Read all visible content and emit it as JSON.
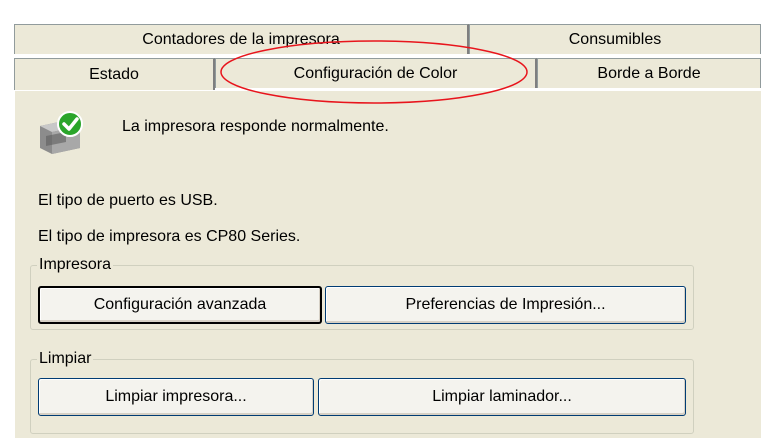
{
  "tabs_back": {
    "printer_counters": "Contadores de la impresora",
    "consumables": "Consumibles"
  },
  "tabs_front": {
    "status": "Estado",
    "color_config": "Configuración de Color",
    "borderless": "Borde a Borde"
  },
  "status_message": "La impresora responde normalmente.",
  "port_info": "El tipo de puerto es USB.",
  "printer_type_info": "El tipo de impresora es CP80 Series.",
  "printer_group": {
    "legend": "Impresora",
    "advanced_button": "Configuración avanzada",
    "preferences_button": "Preferencias de Impresión..."
  },
  "clean_group": {
    "legend": "Limpiar",
    "clean_printer_button": "Limpiar impresora...",
    "clean_laminator_button": "Limpiar laminador..."
  },
  "colors": {
    "panel": "#ece9d8",
    "highlight_circle": "#e8141c"
  },
  "icons": {
    "status": "printer-ok-icon"
  }
}
